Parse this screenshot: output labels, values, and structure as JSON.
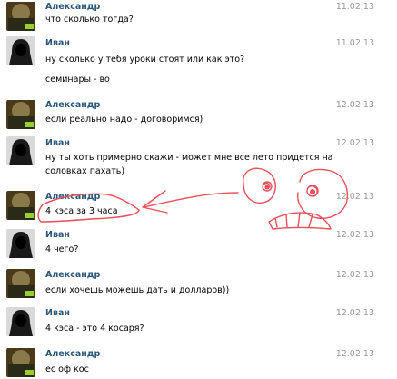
{
  "messages": [
    {
      "sender": "Александр",
      "date": "11.02.13",
      "avatar": "alexander-avatar",
      "lines": [
        "что сколько тогда?"
      ]
    },
    {
      "sender": "Иван",
      "date": "11.02.13",
      "avatar": "ivan-avatar",
      "lines": [
        "ну сколько у тебя уроки стоят или как это?",
        "семинары - во"
      ]
    },
    {
      "sender": "Александр",
      "date": "12.02.13",
      "avatar": "alexander-avatar",
      "lines": [
        "если реально надо - договоримся)"
      ]
    },
    {
      "sender": "Иван",
      "date": "12.02.13",
      "avatar": "ivan-avatar",
      "lines": [
        "ну ты хоть примерно скажи - может мне все лето придется на",
        "соловках пахать)"
      ]
    },
    {
      "sender": "Александр",
      "date": "12.02.13",
      "avatar": "alexander-avatar",
      "lines": [
        "4 кэса за 3 часа"
      ]
    },
    {
      "sender": "Иван",
      "date": "12.02.13",
      "avatar": "ivan-avatar",
      "lines": [
        "4 чего?"
      ]
    },
    {
      "sender": "Александр",
      "date": "12.02.13",
      "avatar": "alexander-avatar",
      "lines": [
        "если хочешь можешь дать и долларов))"
      ]
    },
    {
      "sender": "Иван",
      "date": "12.02.13",
      "avatar": "ivan-avatar",
      "lines": [
        "4 кэса - это 4 косаря?"
      ]
    },
    {
      "sender": "Александр",
      "date": "12.02.13",
      "avatar": "alexander-avatar",
      "lines": [
        "ес оф кос"
      ]
    }
  ],
  "colors": {
    "name": "#2b587a",
    "date": "#999999",
    "text": "#000000",
    "doodle": "#e8505b"
  }
}
